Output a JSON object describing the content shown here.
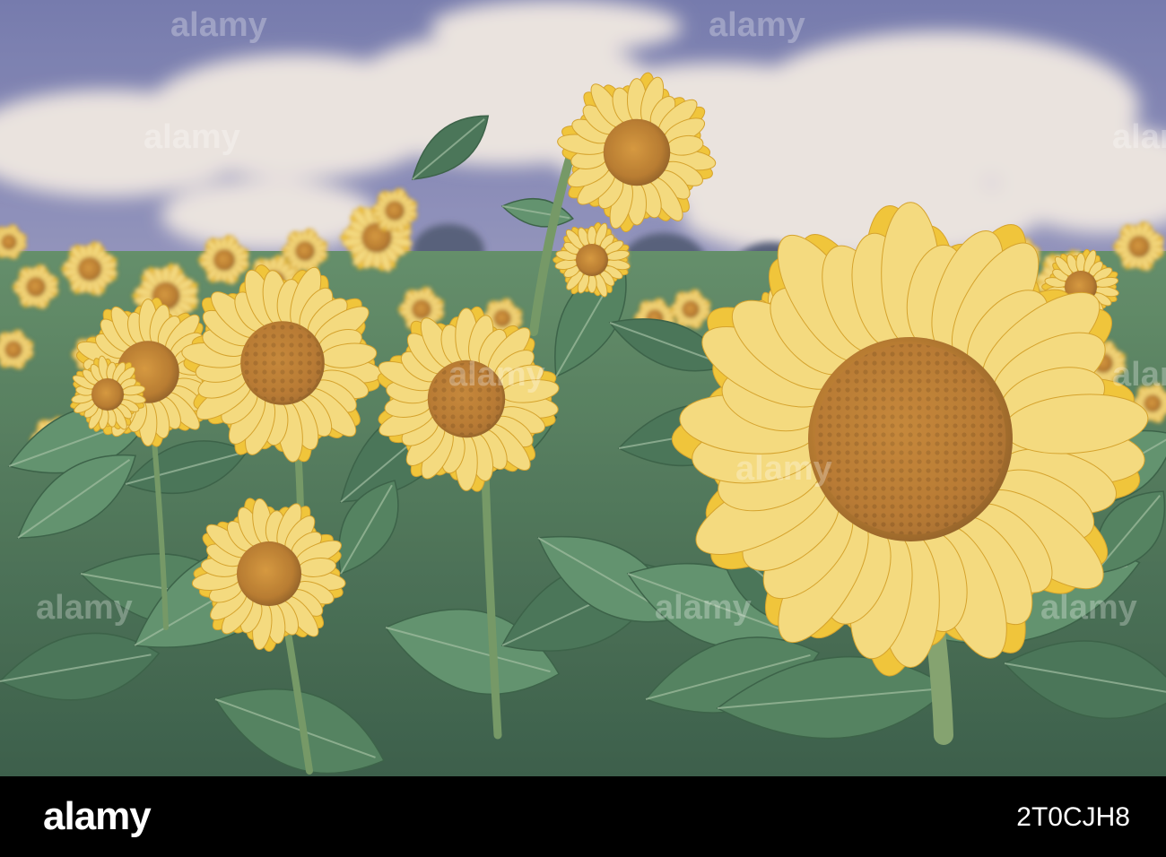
{
  "footer": {
    "brand": "alamy",
    "image_id": "2T0CJH8"
  },
  "watermark": {
    "text": "alamy"
  },
  "palette": {
    "sky_top": "#7d86b4",
    "sky_bottom": "#b8b8cf",
    "cloud": "#f1eee6",
    "petal": "#f6cb2e",
    "petal_light": "#fbe27a",
    "disk": "#c98b2a",
    "disk_dark": "#8a5a1a",
    "leaf": "#4f8a5e",
    "leaf_dark": "#2f5e3e"
  }
}
